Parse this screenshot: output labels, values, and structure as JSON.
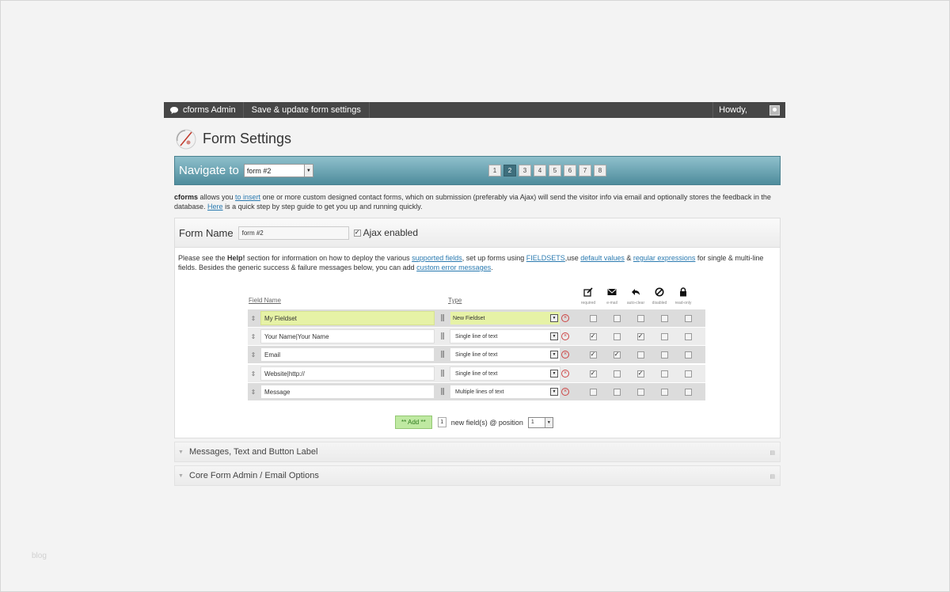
{
  "adminbar": {
    "brand": "cforms Admin",
    "save": "Save & update form settings",
    "howdy": "Howdy,"
  },
  "page_title": "Form Settings",
  "navigate": {
    "label": "Navigate to",
    "selected_form": "form #2",
    "pages": [
      "1",
      "2",
      "3",
      "4",
      "5",
      "6",
      "7",
      "8"
    ],
    "active_page": "2"
  },
  "intro": {
    "brand": "cforms",
    "t1": " allows you ",
    "link1": "to insert",
    "t2": " one or more custom designed contact forms, which on submission (preferably via Ajax) will send the visitor info via email and optionally stores the feedback in the database. ",
    "link2": "Here",
    "t3": " is a quick step by step guide to get you up and running quickly."
  },
  "form": {
    "name_label": "Form Name",
    "name_value": "form #2",
    "ajax_label": "Ajax enabled",
    "ajax_checked": true,
    "help": {
      "t1": "Please see the ",
      "bold": "Help!",
      "t2": " section for information on how to deploy the various ",
      "l1": "supported fields",
      "t3": ", set up forms using ",
      "l2": "FIELDSETS",
      "t4": ",use ",
      "l3": "default values",
      "t5": " & ",
      "l4": "regular expressions",
      "t6": " for single & multi-line fields. Besides the generic success & failure messages below, you can add ",
      "l5": "custom error messages",
      "t7": "."
    },
    "col_field_name": "Field Name",
    "col_type": "Type",
    "options": [
      {
        "icon": "edit-icon",
        "label": "required"
      },
      {
        "icon": "email-icon",
        "label": "e-mail"
      },
      {
        "icon": "reply-icon",
        "label": "auto-clear"
      },
      {
        "icon": "disabled-icon",
        "label": "disabled"
      },
      {
        "icon": "lock-icon",
        "label": "read-only"
      }
    ],
    "fields": [
      {
        "name": "My Fieldset",
        "type": "New Fieldset",
        "fieldset": true,
        "checks": [
          false,
          false,
          false,
          false,
          false
        ]
      },
      {
        "name": "Your Name|Your Name",
        "type": "Single line of text",
        "fieldset": false,
        "checks": [
          true,
          false,
          true,
          false,
          false
        ]
      },
      {
        "name": "Email",
        "type": "Single line of text",
        "fieldset": false,
        "checks": [
          true,
          true,
          false,
          false,
          false
        ]
      },
      {
        "name": "Website|http://",
        "type": "Single line of text",
        "fieldset": false,
        "checks": [
          true,
          false,
          true,
          false,
          false
        ]
      },
      {
        "name": "Message",
        "type": "Multiple lines of text",
        "fieldset": false,
        "checks": [
          false,
          false,
          false,
          false,
          false
        ]
      }
    ],
    "add": {
      "button": "** Add **",
      "count": "1",
      "text": "new field(s) @ position",
      "position": "1"
    }
  },
  "sections": [
    "Messages, Text and Button Label",
    "Core Form Admin / Email Options"
  ],
  "watermark": "blog"
}
